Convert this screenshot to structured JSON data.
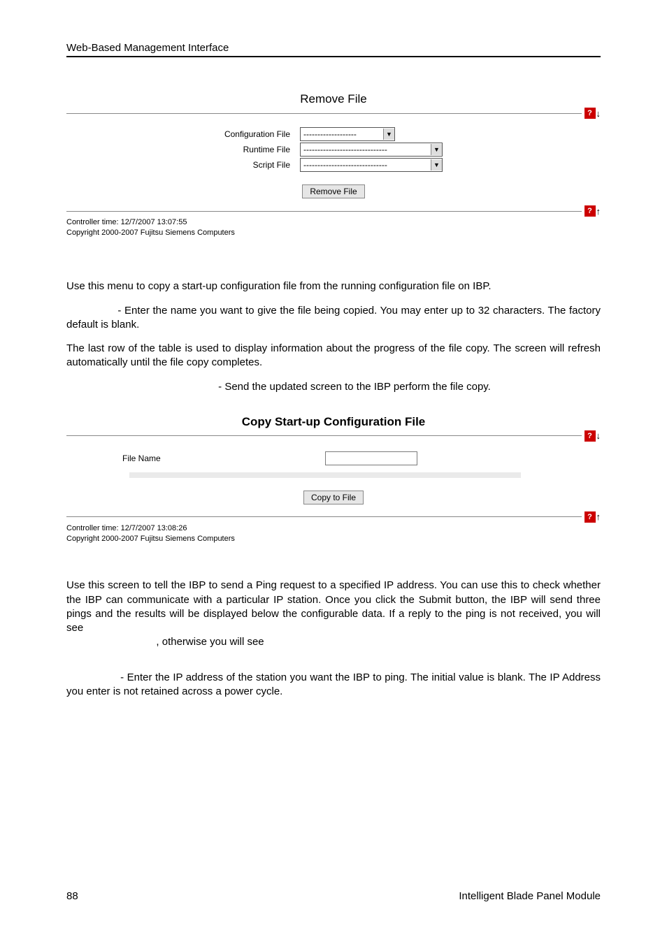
{
  "header": "Web-Based Management Interface",
  "panel1": {
    "title": "Remove File",
    "rows": {
      "config_label": "Configuration File",
      "config_value": "-------------------",
      "runtime_label": "Runtime File",
      "runtime_value": "------------------------------",
      "script_label": "Script File",
      "script_value": "------------------------------"
    },
    "button": "Remove File",
    "controller_time": "Controller time: 12/7/2007 13:07:55",
    "copyright": "Copyright 2000-2007 Fujitsu Siemens Computers"
  },
  "text1": {
    "intro": "Use this menu to copy a start-up configuration file from the running configuration file on IBP.",
    "fname_line": "- Enter the name you want to give the file being copied. You may enter up to 32 characters. The factory default is blank.",
    "last_row": "The last row of the table is used to display information about the progress of the file copy. The screen will refresh automatically until the file copy completes.",
    "send_line": "- Send the updated screen to the IBP perform the file copy."
  },
  "panel2": {
    "title": "Copy Start-up Configuration File",
    "fname_label": "File Name",
    "button": "Copy to File",
    "controller_time": "Controller time: 12/7/2007 13:08:26",
    "copyright": "Copyright 2000-2007 Fujitsu Siemens Computers"
  },
  "text2": {
    "ping_intro": "Use this screen to tell the IBP to send a Ping request to a specified IP address. You can use this to check whether the IBP can communicate with a particular IP station. Once you click the Submit button, the IBP will send three pings and the results will be displayed below the configurable data. If a reply to the ping is not received, you will see",
    "otherwise": ", otherwise you will see",
    "ip_line": "- Enter the IP address of the station you want the IBP to ping. The initial value is blank. The IP Address you enter is not retained across a power cycle."
  },
  "footer": {
    "page_num": "88",
    "doc_title": "Intelligent Blade Panel Module"
  }
}
